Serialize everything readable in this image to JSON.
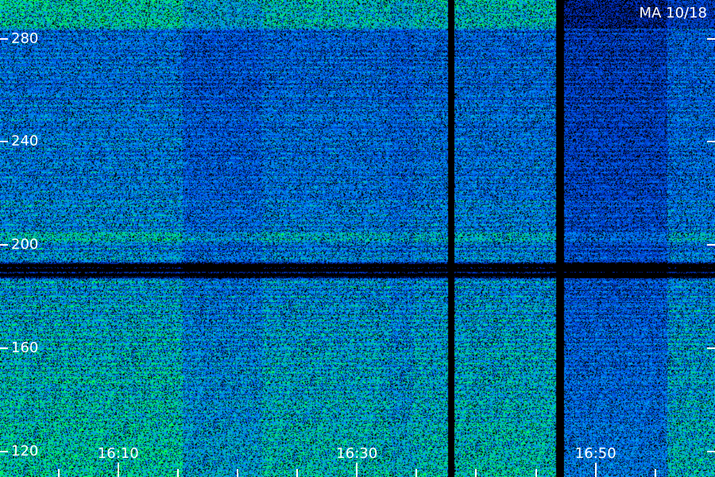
{
  "station_label": "MA 10/18",
  "frequency_axis": {
    "ticks": [
      280,
      240,
      200,
      160,
      120
    ],
    "range": [
      110,
      295
    ]
  },
  "time_axis": {
    "major_labels": [
      "16:10",
      "16:30",
      "16:50"
    ],
    "major_minutes": [
      10,
      30,
      50
    ],
    "minor_minutes": [
      5,
      15,
      20,
      25,
      35,
      40,
      45,
      55
    ],
    "range_minutes": [
      0.1,
      60
    ]
  },
  "colors": {
    "background": "#000000",
    "low": "#0000b4",
    "mid": "#0096ff",
    "high": "#00ff4a",
    "text": "#ffffff"
  }
}
